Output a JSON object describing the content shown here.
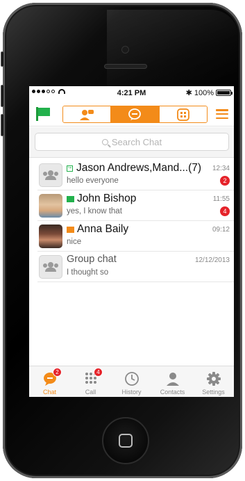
{
  "statusbar": {
    "time": "4:21 PM",
    "battery": "100%",
    "bluetooth": "✱"
  },
  "toolbar": {
    "segments": [
      {
        "name": "contacts",
        "icon": "person-chat-icon"
      },
      {
        "name": "chat",
        "icon": "chat-bubble-icon"
      },
      {
        "name": "dialpad",
        "icon": "dialpad-icon"
      }
    ],
    "active_segment": "chat",
    "colors": {
      "accent": "#f38b19",
      "status_flag": "#22b14c",
      "badge": "#e5232a"
    }
  },
  "search": {
    "placeholder": "Search Chat"
  },
  "chats": [
    {
      "name": "Jason Andrews,Mand...(7)",
      "message": "hello everyone",
      "time": "12:34",
      "unread": "2",
      "avatar": "group"
    },
    {
      "name": "John Bishop",
      "message": "yes, I know that",
      "time": "11:55",
      "unread": "4",
      "avatar": "photo"
    },
    {
      "name": "Anna Baily",
      "message": "nice",
      "time": "09:12",
      "unread": "",
      "avatar": "photo"
    },
    {
      "name": "Group chat",
      "message": "I thought so",
      "time": "12/12/2013",
      "unread": "",
      "avatar": "group"
    }
  ],
  "tabs": [
    {
      "label": "Chat",
      "badge": "2",
      "icon": "chat-icon"
    },
    {
      "label": "Call",
      "badge": "4",
      "icon": "keypad-icon"
    },
    {
      "label": "History",
      "badge": "",
      "icon": "clock-icon"
    },
    {
      "label": "Contacts",
      "badge": "",
      "icon": "person-icon"
    },
    {
      "label": "Settings",
      "badge": "",
      "icon": "gear-icon"
    }
  ]
}
